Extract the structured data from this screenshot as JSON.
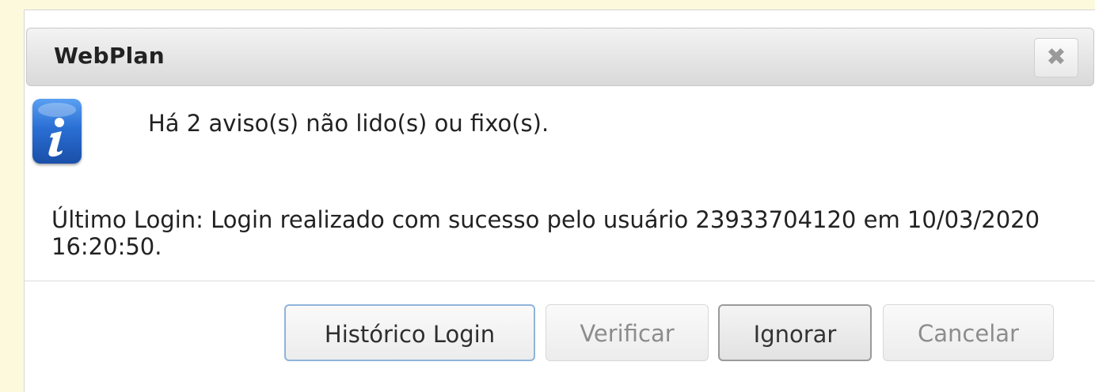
{
  "dialog": {
    "title": "WebPlan",
    "close_symbol": "✖",
    "icon": "info-icon",
    "message": "Há 2 aviso(s) não lido(s) ou fixo(s).",
    "last_login": "Último Login: Login realizado com sucesso pelo usuário 23933704120 em 10/03/2020 16:20:50."
  },
  "buttons": {
    "history": "Histórico Login",
    "verify": "Verificar",
    "ignore": "Ignorar",
    "cancel": "Cancelar"
  },
  "colors": {
    "backdrop": "#fdf9dd",
    "icon_blue": "#2a6fd4",
    "focus_border": "#8fb4d9"
  }
}
